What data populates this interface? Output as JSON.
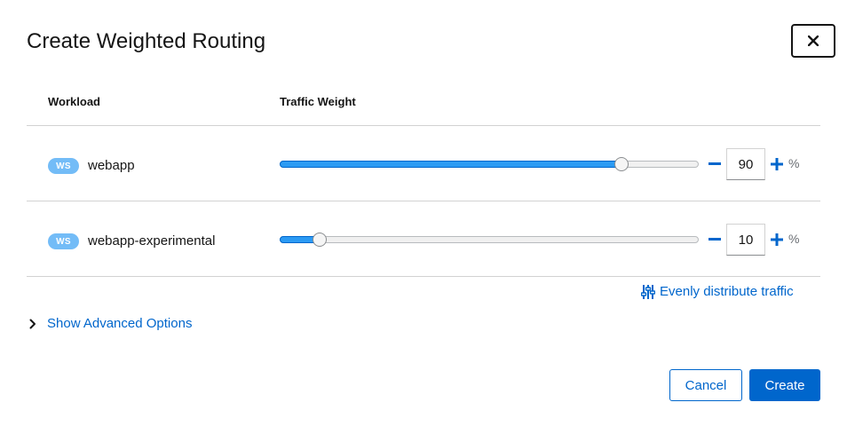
{
  "modal": {
    "title": "Create Weighted Routing",
    "close_icon": "close-icon"
  },
  "table": {
    "headers": {
      "workload": "Workload",
      "traffic_weight": "Traffic Weight"
    },
    "rows": [
      {
        "badge": "WS",
        "name": "webapp",
        "weight": "90",
        "weight_fraction": 0.9,
        "unit": "%"
      },
      {
        "badge": "WS",
        "name": "webapp-experimental",
        "weight": "10",
        "weight_fraction": 0.1,
        "unit": "%"
      }
    ]
  },
  "actions": {
    "distribute_label": "Evenly distribute traffic",
    "distribute_icon": "sliders-icon",
    "advanced_label": "Show Advanced Options",
    "advanced_icon": "chevron-right-icon",
    "cancel_label": "Cancel",
    "create_label": "Create"
  },
  "colors": {
    "primary": "#0066cc",
    "slider_fill": "#2b9af3",
    "badge": "#73bcf7"
  }
}
